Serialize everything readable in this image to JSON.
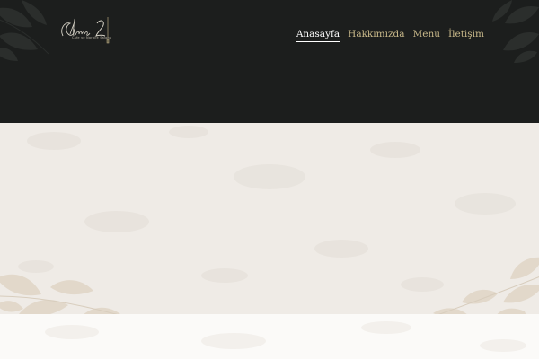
{
  "logo": {
    "script_text": "Elvas 2",
    "tagline": "Cafe ve Nargile Salonu"
  },
  "nav": {
    "items": [
      {
        "label": "Anasayfa",
        "active": true
      },
      {
        "label": "Hakkımızda",
        "active": false
      },
      {
        "label": "Menu",
        "active": false
      },
      {
        "label": "İletişim",
        "active": false
      }
    ]
  },
  "colors": {
    "header_bg": "#1c1e1d",
    "hero_bg": "#efebe6",
    "bottom_bg": "#fbfaf8",
    "accent_gold": "#c9b98a",
    "nav_active": "#ffffff"
  }
}
